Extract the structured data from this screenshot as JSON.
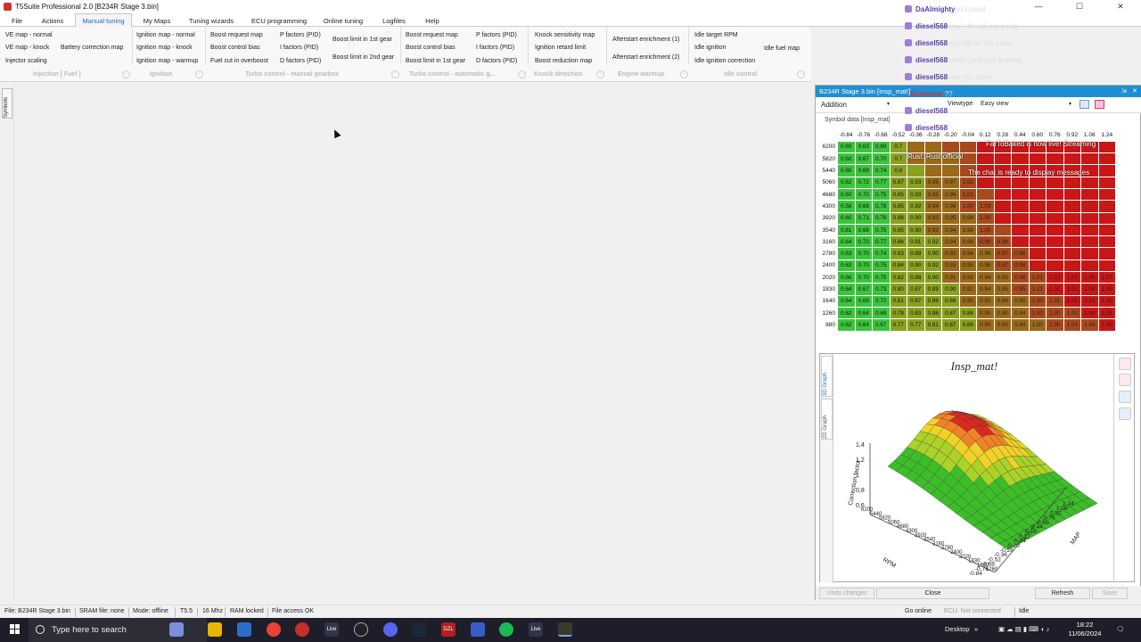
{
  "window": {
    "title": "T5Suite Professional 2.0 [B234R Stage 3.bin]",
    "minimize": "—",
    "maximize": "☐",
    "close": "✕"
  },
  "menu": [
    "File",
    "Actions",
    "Manual tuning",
    "My Maps",
    "Tuning wizards",
    "ECU programming",
    "Online tuning",
    "Logfiles",
    "Help"
  ],
  "ribbon": {
    "items": [
      "VE map - normal",
      "VE map - knock",
      "Injector scaling",
      "Battery correction map",
      "Ignition map - normal",
      "Ignition map - knock",
      "Ignition map - warmup",
      "Boost request map",
      "Boost control bias",
      "Fuel cut in overboost",
      "P factors (PID)",
      "I factors (PID)",
      "D factors (PID)",
      "Boost limit in 1st gear",
      "Boost limit in 2nd gear",
      "Boost request map",
      "Boost control bias",
      "Boost limit in 1st gear",
      "P factors (PID)",
      "I factors (PID)",
      "D factors (PID)",
      "Knock sensitivity map",
      "Ignition retard limit",
      "Boost reduction map",
      "Afterstart enrichment (1)",
      "Afterstart enrichment (2)",
      "Idle target RPM",
      "Idle ignition",
      "Idle ignition correction",
      "Idle fuel map"
    ],
    "groups": [
      "Injection [ Fuel ]",
      "Ignition",
      "Turbo control - manual gearbox",
      "Turbo control - automatic g...",
      "Knock detection",
      "Engine warmup",
      "Idle control"
    ]
  },
  "sidebar": {
    "symbols_tab": "Symbols"
  },
  "status": {
    "items": [
      "File: B234R Stage 3.bin",
      "SRAM file: none",
      "Mode: offline",
      "T5.5",
      "16 Mhz",
      "RAM locked",
      "File access OK"
    ],
    "right": [
      "Go online",
      "ECU: Not connected",
      "Idle"
    ]
  },
  "map_window": {
    "title": "B234R Stage 3.bin [Insp_mat!]",
    "mode": "Addition",
    "viewtype_label": "Viewtype",
    "viewtype_value": "Easy view",
    "symbol_data_label": "Symbol data [Insp_mat]",
    "columns": [
      "-0.84",
      "-0.76",
      "-0.68",
      "-0.52",
      "-0.36",
      "-0.28",
      "-0.20",
      "-0.04",
      "0.12",
      "0.28",
      "0.44",
      "0.60",
      "0.76",
      "0.92",
      "1.08",
      "1.24"
    ],
    "rows": [
      {
        "rpm": "6200",
        "vals": [
          "0.60",
          "0.63",
          "0.69",
          "0.7",
          "",
          "",
          "",
          "",
          "",
          "",
          "",
          "",
          "",
          "",
          "",
          ""
        ]
      },
      {
        "rpm": "5820",
        "vals": [
          "0.60",
          "0.67",
          "0.70",
          "0.7",
          "",
          "",
          "",
          "",
          "",
          "",
          "",
          "",
          "",
          "",
          "",
          ""
        ]
      },
      {
        "rpm": "5440",
        "vals": [
          "0.60",
          "0.69",
          "0.74",
          "0.8",
          "",
          "",
          "",
          "",
          "",
          "",
          "",
          "",
          "",
          "",
          "",
          ""
        ]
      },
      {
        "rpm": "5060",
        "vals": [
          "0.62",
          "0.72",
          "0.77",
          "0.87",
          "0.93",
          "0.95",
          "0.97",
          "1.02",
          "",
          "",
          "",
          "",
          "",
          "",
          "",
          ""
        ]
      },
      {
        "rpm": "4680",
        "vals": [
          "0.60",
          "0.70",
          "0.75",
          "0.85",
          "0.93",
          "0.95",
          "0.96",
          "1.01",
          "",
          "",
          "",
          "",
          "",
          "",
          "",
          ""
        ]
      },
      {
        "rpm": "4300",
        "vals": [
          "0.58",
          "0.68",
          "0.78",
          "0.85",
          "0.92",
          "0.94",
          "0.96",
          "1.00",
          "1.03",
          "",
          "",
          "",
          "",
          "",
          "",
          ""
        ]
      },
      {
        "rpm": "3920",
        "vals": [
          "0.60",
          "0.71",
          "0.76",
          "0.86",
          "0.90",
          "0.93",
          "0.95",
          "0.98",
          "1.00",
          "",
          "",
          "",
          "",
          "",
          "",
          ""
        ]
      },
      {
        "rpm": "3540",
        "vals": [
          "0.61",
          "0.68",
          "0.75",
          "0.85",
          "0.90",
          "0.93",
          "0.94",
          "0.98",
          "1.00",
          "",
          "",
          "",
          "",
          "",
          "",
          ""
        ]
      },
      {
        "rpm": "3160",
        "vals": [
          "0.64",
          "0.70",
          "0.77",
          "0.86",
          "0.91",
          "0.92",
          "0.94",
          "0.96",
          "0.98",
          "0.98",
          "",
          "",
          "",
          "",
          "",
          ""
        ]
      },
      {
        "rpm": "2780",
        "vals": [
          "0.63",
          "0.70",
          "0.74",
          "0.83",
          "0.89",
          "0.90",
          "0.92",
          "0.94",
          "0.96",
          "0.97",
          "0.98",
          "",
          "",
          "",
          "",
          ""
        ]
      },
      {
        "rpm": "2400",
        "vals": [
          "0.63",
          "0.70",
          "0.75",
          "0.84",
          "0.90",
          "0.92",
          "0.93",
          "0.95",
          "0.96",
          "0.97",
          "0.98",
          "",
          "",
          "",
          "",
          ""
        ]
      },
      {
        "rpm": "2020",
        "vals": [
          "0.66",
          "0.70",
          "0.75",
          "0.82",
          "0.88",
          "0.90",
          "0.91",
          "0.93",
          "0.94",
          "0.95",
          "0.96",
          "1.01",
          "1.02",
          "1.03",
          "1.05",
          "1.07"
        ]
      },
      {
        "rpm": "1830",
        "vals": [
          "0.64",
          "0.67",
          "0.73",
          "0.80",
          "0.87",
          "0.89",
          "0.90",
          "0.92",
          "0.94",
          "0.95",
          "0.95",
          "1.01",
          "1.02",
          "1.03",
          "1.04",
          "1.06"
        ]
      },
      {
        "rpm": "1640",
        "vals": [
          "0.64",
          "0.69",
          "0.72",
          "0.81",
          "0.87",
          "0.86",
          "0.88",
          "0.90",
          "0.92",
          "0.94",
          "0.95",
          "1.00",
          "1.01",
          "1.02",
          "1.03",
          "1.05"
        ]
      },
      {
        "rpm": "1260",
        "vals": [
          "0.62",
          "0.64",
          "0.69",
          "0.78",
          "0.83",
          "0.86",
          "0.87",
          "0.88",
          "0.90",
          "0.90",
          "0.94",
          "1.00",
          "1.00",
          "1.00",
          "1.04",
          "1.05"
        ]
      },
      {
        "rpm": "880",
        "vals": [
          "0.62",
          "0.64",
          "0.67",
          "0.77",
          "0.77",
          "0.81",
          "0.87",
          "0.89",
          "0.90",
          "0.90",
          "0.94",
          "1.00",
          "1.00",
          "1.03",
          "1.04",
          "1.05"
        ]
      }
    ],
    "graph": {
      "title": "Insp_mat!",
      "tab_3d": "3D Graph",
      "tab_2d": "2D Graph",
      "z_label": "Correction factor",
      "x_label": "RPM",
      "y_label": "MAP",
      "z_ticks": [
        "1,4",
        "1,2",
        "1",
        "0,8",
        "0,6"
      ],
      "rpm_ticks": [
        "6200",
        "5440",
        "5820",
        "5060",
        "4680",
        "4300",
        "3920",
        "3540",
        "3160",
        "2780",
        "2400",
        "2020",
        "1830",
        "1640",
        "1260"
      ],
      "map_ticks": [
        "1.24",
        "1.08",
        "0.92",
        "0.76",
        "0.60",
        "0.44",
        "0.28",
        "0.12",
        "-0.04",
        "-0.20",
        "-0.28",
        "-0.36",
        "-0.52",
        "-0.68",
        "-0.76",
        "-0.84"
      ]
    },
    "buttons": {
      "undo": "Undo changes",
      "close": "Close",
      "refresh": "Refresh",
      "save": "Save"
    }
  },
  "chat": [
    {
      "user": "DaAlmighty",
      "msg": "yo locked"
    },
    {
      "user": "diesel568",
      "msg": "how's the ldi car going"
    },
    {
      "user": "diesel568",
      "msg": "you still on the turbo"
    },
    {
      "user": "diesel568",
      "msg": "boost good just grafting"
    },
    {
      "user": "diesel568",
      "msg": "how you been"
    },
    {
      "user": "Restream",
      "msg": "??"
    },
    {
      "user": "diesel568",
      "msg": ""
    },
    {
      "user": "diesel568",
      "msg": ""
    }
  ],
  "chat_system": [
    "FarToBaked is now live! Streaming",
    "Rust: Rust official",
    "The chat is ready to display messages"
  ],
  "taskbar": {
    "search_placeholder": "Type here to search",
    "desktop": "Desktop",
    "time": "18:22",
    "date": "11/06/2024",
    "app_labels": [
      "Live",
      "DZL",
      "Live"
    ]
  }
}
